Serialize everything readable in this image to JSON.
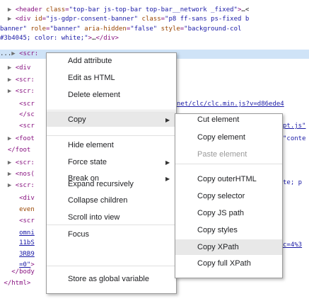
{
  "code_lines": [
    {
      "indent": "  ",
      "tri": "▶",
      "segments": [
        [
          "tag",
          "<header "
        ],
        [
          "attr",
          "class"
        ],
        [
          "tag",
          "="
        ],
        [
          "val",
          "\"top-bar js-top-bar top-bar__network _fixed\""
        ],
        [
          "tag",
          ">"
        ],
        [
          "txt",
          "…<"
        ]
      ]
    },
    {
      "indent": "  ",
      "tri": "▶",
      "segments": [
        [
          "tag",
          "<div "
        ],
        [
          "attr",
          "id"
        ],
        [
          "tag",
          "="
        ],
        [
          "val",
          "\"js-gdpr-consent-banner\" "
        ],
        [
          "attr",
          "class"
        ],
        [
          "tag",
          "="
        ],
        [
          "val",
          "\"p8 ff-sans ps-fixed b"
        ]
      ]
    },
    {
      "indent": "",
      "tri": "",
      "segments": [
        [
          "val",
          "banner\" "
        ],
        [
          "attr",
          "role"
        ],
        [
          "tag",
          "="
        ],
        [
          "val",
          "\"banner\" "
        ],
        [
          "attr",
          "aria-hidden"
        ],
        [
          "tag",
          "="
        ],
        [
          "val",
          "\"false\" "
        ],
        [
          "attr",
          "style"
        ],
        [
          "tag",
          "="
        ],
        [
          "val",
          "\"background-col"
        ]
      ]
    },
    {
      "indent": "",
      "tri": "",
      "segments": [
        [
          "val",
          "#3b4045; color: white;\""
        ],
        [
          "tag",
          ">"
        ],
        [
          "txt",
          "…"
        ],
        [
          "tag",
          "</div>"
        ]
      ]
    },
    {
      "indent": "...",
      "tri": "▶",
      "segments": [
        [
          "tag",
          "<scr:"
        ]
      ],
      "highlight": true
    },
    {
      "indent": "  ",
      "tri": "▶",
      "segments": [
        [
          "tag",
          "<div"
        ]
      ]
    },
    {
      "indent": "  ",
      "tri": "▶",
      "segments": [
        [
          "tag",
          "<scr:"
        ]
      ]
    },
    {
      "indent": "  ",
      "tri": "▶",
      "segments": [
        [
          "tag",
          "<scr:"
        ]
      ]
    },
    {
      "indent": "     ",
      "tri": "",
      "segments": [
        [
          "tag",
          "<scr"
        ]
      ]
    },
    {
      "indent": "     ",
      "tri": "",
      "segments": [
        [
          "tag",
          "</sc"
        ]
      ]
    },
    {
      "indent": "     ",
      "tri": "",
      "segments": [
        [
          "tag",
          "<scr"
        ]
      ]
    },
    {
      "indent": "  ",
      "tri": "▶",
      "segments": [
        [
          "tag",
          "<foot"
        ]
      ]
    },
    {
      "indent": "  ",
      "tri": "",
      "segments": [
        [
          "tag",
          "</foot"
        ]
      ]
    },
    {
      "indent": "  ",
      "tri": "▶",
      "segments": [
        [
          "tag",
          "<scr:"
        ]
      ]
    },
    {
      "indent": "  ",
      "tri": "▶",
      "segments": [
        [
          "tag",
          "<nos("
        ]
      ]
    },
    {
      "indent": "  ",
      "tri": "▶",
      "segments": [
        [
          "tag",
          "<scr:"
        ]
      ]
    },
    {
      "indent": "     ",
      "tri": "",
      "segments": [
        [
          "tag",
          "<div"
        ]
      ]
    },
    {
      "indent": "     ",
      "tri": "",
      "segments": [
        [
          "attr",
          "even"
        ]
      ]
    },
    {
      "indent": "     ",
      "tri": "",
      "segments": [
        [
          "tag",
          "<scr"
        ]
      ]
    },
    {
      "indent": "     ",
      "tri": "",
      "segments": [
        [
          "link",
          "omni"
        ]
      ]
    },
    {
      "indent": "     ",
      "tri": "",
      "segments": [
        [
          "link",
          "11bS"
        ]
      ]
    },
    {
      "indent": "     ",
      "tri": "",
      "segments": [
        [
          "link",
          "3RB9"
        ]
      ]
    },
    {
      "indent": "     ",
      "tri": "",
      "segments": [
        [
          "link",
          "=0\""
        ],
        [
          "tag",
          ">"
        ]
      ]
    },
    {
      "indent": "   ",
      "tri": "",
      "segments": [
        [
          "tag",
          "</body"
        ]
      ]
    },
    {
      "indent": " ",
      "tri": "",
      "segments": [
        [
          "tag",
          "</html>"
        ]
      ]
    }
  ],
  "right_fragments": [
    {
      "text": "net/clc/clc.min.js?v=d86ede4",
      "kind": "link"
    },
    {
      "text": "pt.js\"",
      "kind": "link"
    },
    {
      "text": "\"conte",
      "kind": "val"
    },
    {
      "text": "te; p",
      "kind": "val"
    },
    {
      "text": "c=4%3",
      "kind": "link"
    }
  ],
  "context_menu": {
    "items": [
      {
        "label": "Add attribute"
      },
      {
        "label": "Edit as HTML"
      },
      {
        "label": "Delete element"
      },
      {
        "label": "Copy",
        "submenu": true,
        "highlighted": true
      },
      {
        "label": "Hide element"
      },
      {
        "label": "Force state",
        "submenu": true
      },
      {
        "label": "Break on",
        "submenu": true
      },
      {
        "label": "Expand recursively"
      },
      {
        "label": "Collapse children"
      },
      {
        "label": "Scroll into view"
      },
      {
        "label": "Focus"
      },
      {
        "label": "Store as global variable"
      }
    ]
  },
  "copy_submenu": {
    "items": [
      {
        "label": "Cut element"
      },
      {
        "label": "Copy element"
      },
      {
        "label": "Paste element",
        "disabled": true
      },
      {
        "label": "Copy outerHTML"
      },
      {
        "label": "Copy selector"
      },
      {
        "label": "Copy JS path"
      },
      {
        "label": "Copy styles"
      },
      {
        "label": "Copy XPath",
        "highlighted": true
      },
      {
        "label": "Copy full XPath"
      }
    ]
  }
}
